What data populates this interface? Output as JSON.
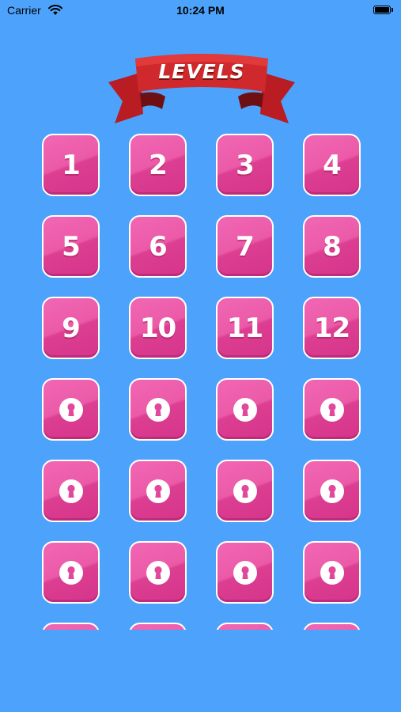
{
  "status_bar": {
    "carrier": "Carrier",
    "time": "10:24 PM"
  },
  "banner": {
    "title": "LEVELS"
  },
  "colors": {
    "background": "#4da3fb",
    "tile_pink": "#eb5aa7",
    "tile_border": "#ffffff",
    "ribbon_red": "#c8262a"
  },
  "levels": [
    {
      "label": "1",
      "locked": false
    },
    {
      "label": "2",
      "locked": false
    },
    {
      "label": "3",
      "locked": false
    },
    {
      "label": "4",
      "locked": false
    },
    {
      "label": "5",
      "locked": false
    },
    {
      "label": "6",
      "locked": false
    },
    {
      "label": "7",
      "locked": false
    },
    {
      "label": "8",
      "locked": false
    },
    {
      "label": "9",
      "locked": false
    },
    {
      "label": "10",
      "locked": false
    },
    {
      "label": "11",
      "locked": false
    },
    {
      "label": "12",
      "locked": false
    },
    {
      "label": "",
      "locked": true,
      "icon": "keyhole-lock-icon"
    },
    {
      "label": "",
      "locked": true,
      "icon": "keyhole-lock-icon"
    },
    {
      "label": "",
      "locked": true,
      "icon": "keyhole-lock-icon"
    },
    {
      "label": "",
      "locked": true,
      "icon": "keyhole-lock-icon"
    },
    {
      "label": "",
      "locked": true,
      "icon": "keyhole-lock-icon"
    },
    {
      "label": "",
      "locked": true,
      "icon": "keyhole-lock-icon"
    },
    {
      "label": "",
      "locked": true,
      "icon": "keyhole-lock-icon"
    },
    {
      "label": "",
      "locked": true,
      "icon": "keyhole-lock-icon"
    },
    {
      "label": "",
      "locked": true,
      "icon": "keyhole-lock-icon"
    },
    {
      "label": "",
      "locked": true,
      "icon": "keyhole-lock-icon"
    },
    {
      "label": "",
      "locked": true,
      "icon": "keyhole-lock-icon"
    },
    {
      "label": "",
      "locked": true,
      "icon": "keyhole-lock-icon"
    },
    {
      "label": "",
      "locked": true,
      "icon": "keyhole-lock-icon"
    },
    {
      "label": "",
      "locked": true,
      "icon": "keyhole-lock-icon"
    },
    {
      "label": "",
      "locked": true,
      "icon": "keyhole-lock-icon"
    },
    {
      "label": "",
      "locked": true,
      "icon": "keyhole-lock-icon"
    }
  ]
}
